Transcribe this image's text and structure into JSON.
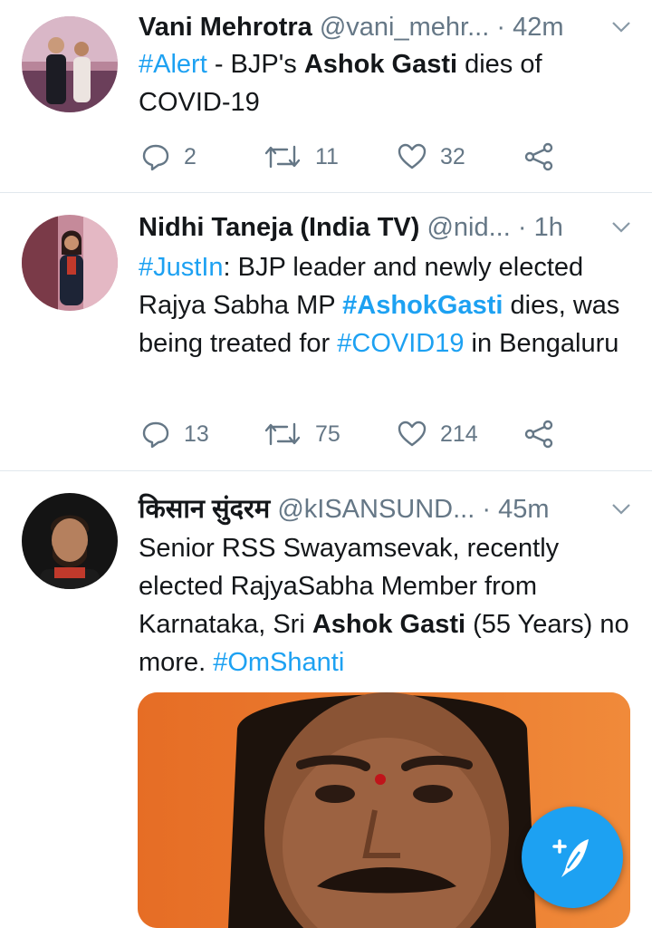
{
  "tweets": [
    {
      "name": "Vani Mehrotra",
      "handle": "@vani_mehr...",
      "sep": "·",
      "time": "42m",
      "body": [
        {
          "t": "#Alert",
          "k": "tag"
        },
        {
          "t": " - BJP's ",
          "k": "plain"
        },
        {
          "t": "Ashok Gasti",
          "k": "bold"
        },
        {
          "t": " dies of COVID-19",
          "k": "plain"
        }
      ],
      "replies": "2",
      "retweets": "11",
      "likes": "32"
    },
    {
      "name": "Nidhi Taneja (India TV)",
      "handle": "@nid...",
      "sep": "·",
      "time": "1h",
      "body": [
        {
          "t": "#JustIn",
          "k": "tag"
        },
        {
          "t": ": BJP leader and newly elected Rajya Sabha MP ",
          "k": "plain"
        },
        {
          "t": "#AshokGasti",
          "k": "tagbold"
        },
        {
          "t": " dies, was being treated for ",
          "k": "plain"
        },
        {
          "t": "#COVID19",
          "k": "tag"
        },
        {
          "t": " in Bengaluru",
          "k": "plain"
        }
      ],
      "replies": "13",
      "retweets": "75",
      "likes": "214"
    },
    {
      "name": "किसान सुंदरम",
      "handle": "@kISANSUND...",
      "sep": "·",
      "time": "45m",
      "body": [
        {
          "t": "Senior RSS Swayamsevak, recently elected RajyaSabha Member from Karnataka, Sri ",
          "k": "plain"
        },
        {
          "t": "Ashok Gasti",
          "k": "bold"
        },
        {
          "t": " (55 Years) no more. ",
          "k": "plain"
        },
        {
          "t": "#OmShanti",
          "k": "tag"
        }
      ]
    }
  ],
  "icons": {
    "reply": "reply-icon",
    "retweet": "retweet-icon",
    "like": "heart-icon",
    "share": "share-icon",
    "caret": "chevron-down-icon",
    "compose": "compose-tweet-icon"
  },
  "colors": {
    "accent": "#1da1f2",
    "text": "#14171a",
    "muted": "#657786",
    "divider": "#e1e8ed"
  }
}
